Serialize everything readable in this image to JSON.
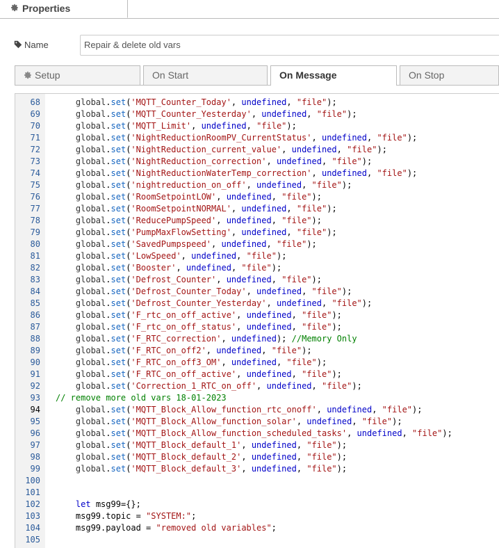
{
  "header": {
    "title": "Properties",
    "icon": "gear-icon"
  },
  "name_field": {
    "label": "Name",
    "value": "Repair & delete old vars",
    "icon": "tag-icon"
  },
  "tabs": [
    {
      "label": "Setup",
      "icon": "gear-icon",
      "active": false
    },
    {
      "label": "On Start",
      "active": false
    },
    {
      "label": "On Message",
      "active": true
    },
    {
      "label": "On Stop",
      "active": false
    }
  ],
  "editor": {
    "highlighted_line": 94,
    "lines": [
      {
        "n": "68",
        "indent": 4,
        "kind": "set",
        "key": "'MQTT_Counter_Today'"
      },
      {
        "n": "69",
        "indent": 4,
        "kind": "set",
        "key": "'MQTT_Counter_Yesterday'"
      },
      {
        "n": "70",
        "indent": 4,
        "kind": "set",
        "key": "'MQTT_Limit'"
      },
      {
        "n": "71",
        "indent": 4,
        "kind": "set",
        "key": "'NightReductionRoomPV_CurrentStatus'"
      },
      {
        "n": "72",
        "indent": 4,
        "kind": "set",
        "key": "'NightReduction_current_value'"
      },
      {
        "n": "73",
        "indent": 4,
        "kind": "set",
        "key": "'NightReduction_correction'"
      },
      {
        "n": "74",
        "indent": 4,
        "kind": "set",
        "key": "'NightReductionWaterTemp_correction'"
      },
      {
        "n": "75",
        "indent": 4,
        "kind": "set",
        "key": "'nightreduction_on_off'"
      },
      {
        "n": "76",
        "indent": 4,
        "kind": "set",
        "key": "'RoomSetpointLOW'"
      },
      {
        "n": "77",
        "indent": 4,
        "kind": "set",
        "key": "'RoomSetpointNORMAL'"
      },
      {
        "n": "78",
        "indent": 4,
        "kind": "set",
        "key": "'ReducePumpSpeed'"
      },
      {
        "n": "79",
        "indent": 4,
        "kind": "set",
        "key": "'PumpMaxFlowSetting'"
      },
      {
        "n": "80",
        "indent": 4,
        "kind": "set",
        "key": "'SavedPumpspeed'"
      },
      {
        "n": "81",
        "indent": 4,
        "kind": "set",
        "key": "'LowSpeed'"
      },
      {
        "n": "82",
        "indent": 4,
        "kind": "set",
        "key": "'Booster'"
      },
      {
        "n": "83",
        "indent": 4,
        "kind": "set",
        "key": "'Defrost_Counter'"
      },
      {
        "n": "84",
        "indent": 4,
        "kind": "set",
        "key": "'Defrost_Counter_Today'"
      },
      {
        "n": "85",
        "indent": 4,
        "kind": "set",
        "key": "'Defrost_Counter_Yesterday'"
      },
      {
        "n": "86",
        "indent": 4,
        "kind": "set",
        "key": "'F_rtc_on_off_active'"
      },
      {
        "n": "87",
        "indent": 4,
        "kind": "set",
        "key": "'F_rtc_on_off_status'"
      },
      {
        "n": "88",
        "indent": 4,
        "kind": "set_mem",
        "key": "'F_RTC_correction'",
        "comment": "//Memory Only"
      },
      {
        "n": "89",
        "indent": 4,
        "kind": "set",
        "key": "'F_RTC_on_off2'"
      },
      {
        "n": "90",
        "indent": 4,
        "kind": "set",
        "key": "'F_RTC_on_off3_OM'"
      },
      {
        "n": "91",
        "indent": 4,
        "kind": "set",
        "key": "'F_RTC_on_off_active'"
      },
      {
        "n": "92",
        "indent": 4,
        "kind": "set",
        "key": "'Correction_1_RTC_on_off'"
      },
      {
        "n": "93",
        "indent": 0,
        "kind": "comment",
        "text": "// remove more old vars 18-01-2023"
      },
      {
        "n": "94",
        "indent": 4,
        "kind": "set",
        "key": "'MQTT_Block_Allow_function_rtc_onoff'"
      },
      {
        "n": "95",
        "indent": 4,
        "kind": "set",
        "key": "'MQTT_Block_Allow_function_solar'"
      },
      {
        "n": "96",
        "indent": 4,
        "kind": "set",
        "key": "'MQTT_Block_Allow_function_scheduled_tasks'"
      },
      {
        "n": "97",
        "indent": 4,
        "kind": "set",
        "key": "'MQTT_Block_default_1'"
      },
      {
        "n": "98",
        "indent": 4,
        "kind": "set",
        "key": "'MQTT_Block_default_2'"
      },
      {
        "n": "99",
        "indent": 4,
        "kind": "set",
        "key": "'MQTT_Block_default_3'"
      },
      {
        "n": "100",
        "indent": 0,
        "kind": "blank"
      },
      {
        "n": "101",
        "indent": 0,
        "kind": "blank"
      },
      {
        "n": "102",
        "indent": 4,
        "kind": "let",
        "text": "let msg99={};"
      },
      {
        "n": "103",
        "indent": 4,
        "kind": "assign",
        "lhs": "msg99.topic = ",
        "rhs": "\"SYSTEM:\";"
      },
      {
        "n": "104",
        "indent": 4,
        "kind": "assign",
        "lhs": "msg99.payload = ",
        "rhs": "\"removed old variables\";"
      },
      {
        "n": "105",
        "indent": 0,
        "kind": "blank"
      }
    ],
    "tokens": {
      "obj": "global",
      "method": "set",
      "undef": "undefined",
      "file": "\"file\"",
      "let_kw": "let"
    }
  }
}
